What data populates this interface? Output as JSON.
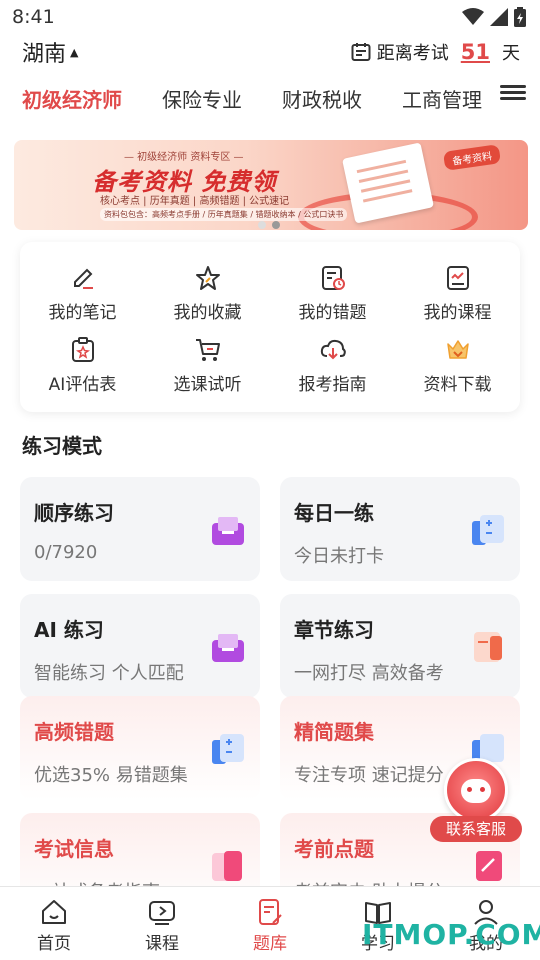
{
  "status": {
    "time": "8:41"
  },
  "header": {
    "region": "湖南",
    "countdown_label": "距离考试",
    "countdown_days": "51",
    "countdown_unit": "天"
  },
  "tabs": [
    "初级经济师",
    "保险专业",
    "财政税收",
    "工商管理"
  ],
  "banner": {
    "sub": "— 初级经济师 资料专区 —",
    "title": "备考资料 免费领",
    "tags": "核心考点 | 历年真题 | 高频错题 | 公式速记",
    "tags2": "资料包包含：高频考点手册 / 历年真题集 / 错题收纳本 / 公式口诀书",
    "badge": "备考资料"
  },
  "quick": [
    {
      "label": "我的笔记",
      "icon": "note-icon"
    },
    {
      "label": "我的收藏",
      "icon": "star-icon"
    },
    {
      "label": "我的错题",
      "icon": "wrong-questions-icon"
    },
    {
      "label": "我的课程",
      "icon": "course-icon"
    },
    {
      "label": "AI评估表",
      "icon": "ai-assess-icon"
    },
    {
      "label": "选课试听",
      "icon": "cart-icon"
    },
    {
      "label": "报考指南",
      "icon": "download-guide-icon"
    },
    {
      "label": "资料下载",
      "icon": "crown-icon"
    }
  ],
  "section_title": "练习模式",
  "practice": [
    {
      "title": "顺序练习",
      "sub": "0/7920",
      "color": "#b14be0"
    },
    {
      "title": "每日一练",
      "sub": "今日未打卡",
      "color": "#4a86f0"
    },
    {
      "title": "AI 练习",
      "sub": "智能练习 个人匹配",
      "color": "#b14be0"
    },
    {
      "title": "章节练习",
      "sub": "一网打尽 高效备考",
      "color": "#f06a4a"
    },
    {
      "title": "高频错题",
      "sub": "优选35% 易错题集",
      "color": "#4a86f0"
    },
    {
      "title": "精简题集",
      "sub": "专注专项 速记提分",
      "color": "#4a86f0"
    },
    {
      "title": "考试信息",
      "sub": "一站式备考指南",
      "color": "#f04a7a"
    },
    {
      "title": "考前点题",
      "sub": "考前突击 助力提分",
      "color": "#f04a7a"
    }
  ],
  "service_label": "联系客服",
  "nav": [
    "首页",
    "课程",
    "题库",
    "学习",
    "我的"
  ],
  "watermark": "ITMOP.COM"
}
